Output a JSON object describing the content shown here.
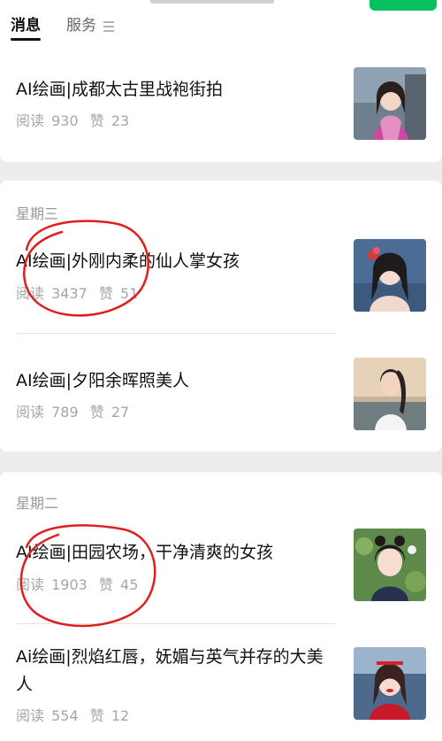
{
  "tabs": {
    "messages": "消息",
    "services": "服务"
  },
  "colors": {
    "accent_green": "#07c160",
    "annotation_red": "#e01e1e"
  },
  "articles": [
    {
      "title": "AI绘画|成都太古里战袍街拍",
      "read_label": "阅读",
      "reads": "930",
      "like_label": "赞",
      "likes": "23"
    },
    {
      "title": "AI绘画|外刚内柔的仙人掌女孩",
      "read_label": "阅读",
      "reads": "3437",
      "like_label": "赞",
      "likes": "51"
    },
    {
      "title": "AI绘画|夕阳余晖照美人",
      "read_label": "阅读",
      "reads": "789",
      "like_label": "赞",
      "likes": "27"
    },
    {
      "title": "AI绘画|田园农场，干净清爽的女孩",
      "read_label": "阅读",
      "reads": "1903",
      "like_label": "赞",
      "likes": "45"
    },
    {
      "title": "Ai绘画|烈焰红唇，妩媚与英气并存的大美人",
      "read_label": "阅读",
      "reads": "554",
      "like_label": "赞",
      "likes": "12"
    }
  ],
  "days": {
    "wednesday": "星期三",
    "tuesday": "星期二"
  }
}
